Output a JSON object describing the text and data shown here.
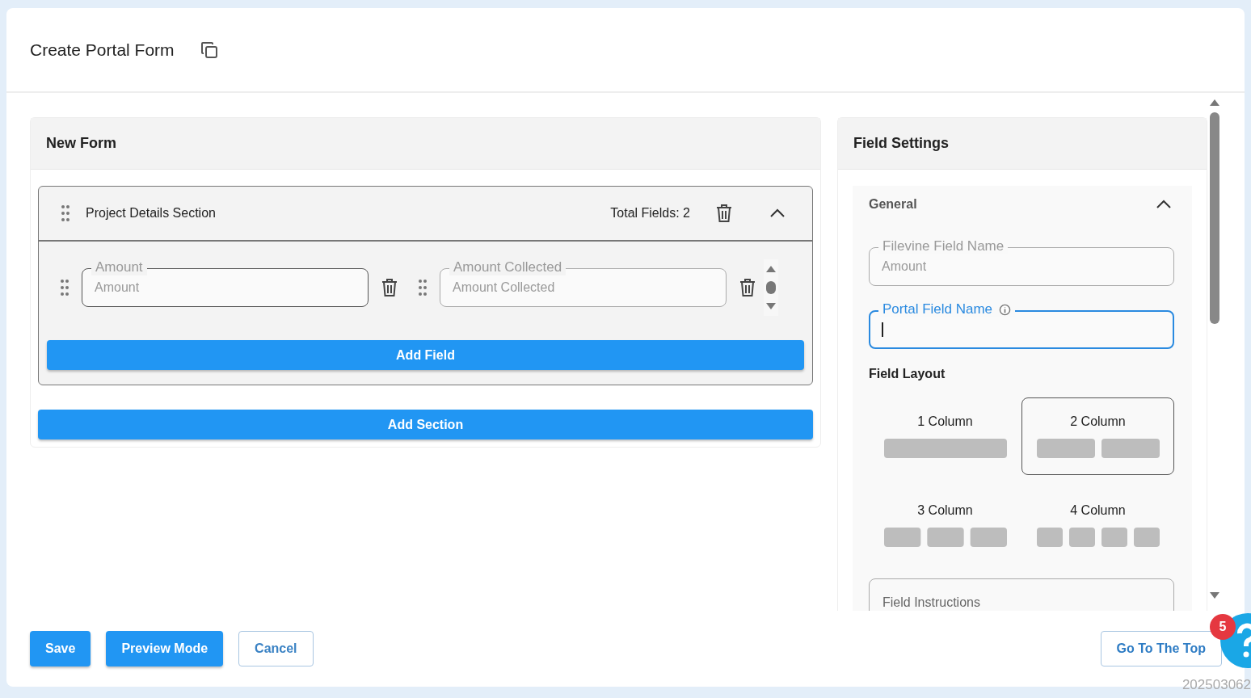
{
  "header": {
    "title": "Create Portal Form"
  },
  "form": {
    "title": "New Form",
    "sections": [
      {
        "title": "Project Details Section",
        "total": "Total Fields: 2",
        "expanded": true,
        "fields": [
          {
            "label": "Amount",
            "value": "Amount",
            "selected": true
          },
          {
            "label": "Amount Collected",
            "value": "Amount Collected",
            "selected": false
          }
        ],
        "add_field": "Add Field"
      }
    ],
    "add_section": "Add Section"
  },
  "settings": {
    "title": "Field Settings",
    "group": {
      "title": "General",
      "expanded": true,
      "filevine_field": {
        "label": "Filevine Field Name",
        "value": "Amount"
      },
      "portal_field": {
        "label": "Portal Field Name",
        "focused": true
      },
      "layout_title": "Field Layout",
      "layouts": [
        {
          "label": "1 Column",
          "selected": false
        },
        {
          "label": "2 Column",
          "selected": true
        },
        {
          "label": "3 Column",
          "selected": false
        },
        {
          "label": "4 Column",
          "selected": false
        }
      ],
      "instructions": {
        "placeholder": "Field Instructions"
      }
    }
  },
  "footer": {
    "buttons": [
      {
        "label": "Save",
        "kind": "primary"
      },
      {
        "label": "Preview Mode",
        "kind": "primary"
      },
      {
        "label": "Cancel",
        "kind": "outline"
      }
    ],
    "top_button": "Go To The Top",
    "help_badge": "5"
  },
  "timestamp": "202503062"
}
